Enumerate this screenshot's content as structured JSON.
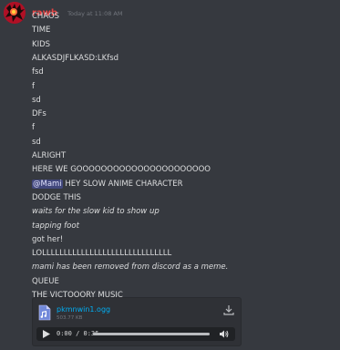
{
  "message": {
    "username": "rawb",
    "timestamp": "Today at 11:08 AM",
    "username_color": "#e64343",
    "lines": [
      {
        "text": "CHAOS"
      },
      {
        "text": "TIME"
      },
      {
        "text": "KIDS"
      },
      {
        "text": "ALKASDJFLKASD:LKfsd"
      },
      {
        "text": "fsd"
      },
      {
        "text": "f"
      },
      {
        "text": "sd"
      },
      {
        "text": "DFs"
      },
      {
        "text": "f"
      },
      {
        "text": "sd"
      },
      {
        "text": "ALRIGHT"
      },
      {
        "text": "HERE WE GOOOOOOOOOOOOOOOOOOOOOO"
      },
      {
        "mention": "@Mami",
        "text": " HEY SLOW ANIME CHARACTER"
      },
      {
        "text": "DODGE THIS"
      },
      {
        "text": "waits for the slow kid to show up",
        "italic": true
      },
      {
        "text": "tapping foot",
        "italic": true
      },
      {
        "text": "got her!"
      },
      {
        "text": "LOLLLLLLLLLLLLLLLLLLLLLLLLLLLLLL"
      },
      {
        "text": "mami has been removed from discord as a meme.",
        "italic": true
      },
      {
        "text": "QUEUE"
      },
      {
        "text": "THE VICTOOORY MUSIC"
      }
    ]
  },
  "attachment": {
    "file_name": "pkmnwin1.ogg",
    "file_size": "503.77 KB",
    "icon": "audio-file-icon",
    "player": {
      "time": "0:00 / 0:36",
      "progress": 0.0,
      "buffered": 1.0
    }
  },
  "colors": {
    "background": "#36393f",
    "text": "#dcddde",
    "link": "#00aff4",
    "mention_bg": "#5865f2"
  }
}
